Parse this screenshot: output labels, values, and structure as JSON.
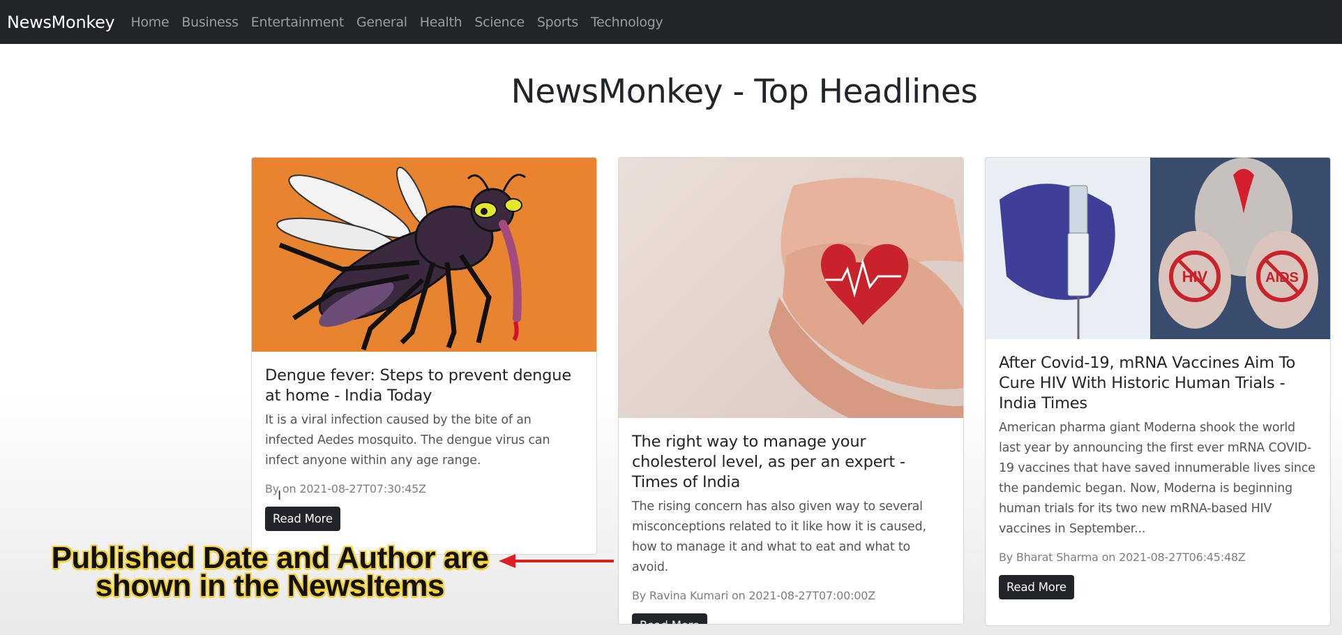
{
  "navbar": {
    "brand": "NewsMonkey",
    "links": [
      "Home",
      "Business",
      "Entertainment",
      "General",
      "Health",
      "Science",
      "Sports",
      "Technology"
    ]
  },
  "page": {
    "heading": "NewsMonkey - Top Headlines"
  },
  "articles": [
    {
      "title": "Dengue fever: Steps to prevent dengue at home - India Today",
      "description": "It is a viral infection caused by the bite of an infected Aedes mosquito. The dengue virus can infect anyone within any age range.",
      "meta": "By on 2021-08-27T07:30:45Z",
      "button": "Read More",
      "image": "mosquito-illustration"
    },
    {
      "title": "The right way to manage your cholesterol level, as per an expert - Times of India",
      "description": "The rising concern has also given way to several misconceptions related to it like how it is caused, how to manage it and what to eat and what to avoid.",
      "meta": "By Ravina Kumari on 2021-08-27T07:00:00Z",
      "button": "Read More",
      "image": "hands-holding-heart"
    },
    {
      "title": "After Covid-19, mRNA Vaccines Aim To Cure HIV With Historic Human Trials - India Times",
      "description": "American pharma giant Moderna shook the world last year by announcing the first ever mRNA COVID-19 vaccines that have saved innumerable lives since the pandemic began. Now, Moderna is beginning human trials for its two new mRNA-based HIV vaccines in September...",
      "meta": "By Bharat Sharma on 2021-08-27T06:45:48Z",
      "button": "Read More",
      "image": "vaccine-and-hiv-awareness",
      "image_labels": [
        "HIV",
        "AIDS"
      ]
    }
  ],
  "annotation": {
    "line1": "Published Date and Author are",
    "line2": "shown in the NewsItems"
  },
  "colors": {
    "navbar": "#212529",
    "button": "#212529",
    "annotation_outline": "#f5d23a",
    "arrow": "#e02020",
    "card1_bg": "#e8832f"
  }
}
